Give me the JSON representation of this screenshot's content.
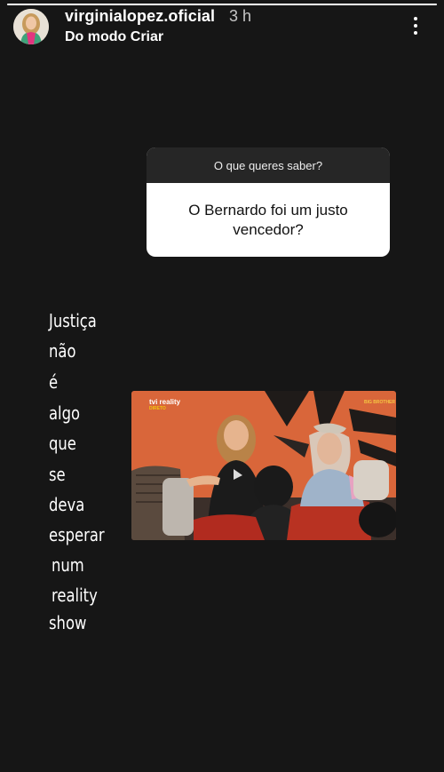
{
  "story": {
    "progress": 1.0
  },
  "header": {
    "username": "virginialopez.oficial",
    "timestamp": "3 h",
    "subtitle": "Do modo Criar",
    "avatar_icon": "profile-avatar",
    "menu_icon": "more-vertical-icon"
  },
  "question_sticker": {
    "prompt": "O que queres saber?",
    "answer": "O Bernardo foi um justo vencedor?"
  },
  "caption": {
    "words": [
      "Justiça",
      "não",
      "é",
      "algo",
      "que",
      "se",
      "deva",
      "esperar",
      "num",
      "reality",
      "show"
    ]
  },
  "photo": {
    "channel_logo": "tvi reality",
    "channel_logo_sub": "DIRETO",
    "show_logo": "BIG BROTHER"
  },
  "colors": {
    "background": "#161616",
    "card_header": "#262626",
    "card_body": "#ffffff",
    "photo_wall": "#d9663a"
  }
}
